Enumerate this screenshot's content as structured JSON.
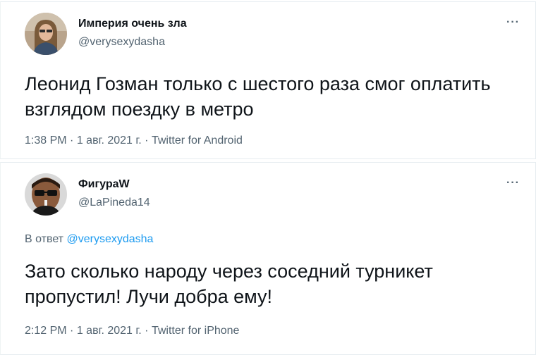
{
  "tweets": [
    {
      "display_name": "Империя очень зла",
      "handle": "@verysexydasha",
      "more": "···",
      "text": "Леонид Гозман только с шестого раза смог оплатить взглядом поездку в метро",
      "time": "1:38 PM",
      "date": "1 авг. 2021 г.",
      "source": "Twitter for Android",
      "separator": "·",
      "avatar_icon": "user-avatar-woman"
    },
    {
      "display_name": "ФигураW",
      "handle": "@LaPineda14",
      "more": "···",
      "reply_prefix": "В ответ",
      "reply_to": "@verysexydasha",
      "text": "Зато сколько народу через соседний турникет пропустил! Лучи добра ему!",
      "time": "2:12 PM",
      "date": "1 авг. 2021 г.",
      "source": "Twitter for iPhone",
      "separator": "·",
      "avatar_icon": "user-avatar-man-sunglasses"
    }
  ],
  "colors": {
    "text": "#0f1419",
    "secondary": "#536471",
    "link": "#1d9bf0",
    "border": "#e6ecf0"
  }
}
